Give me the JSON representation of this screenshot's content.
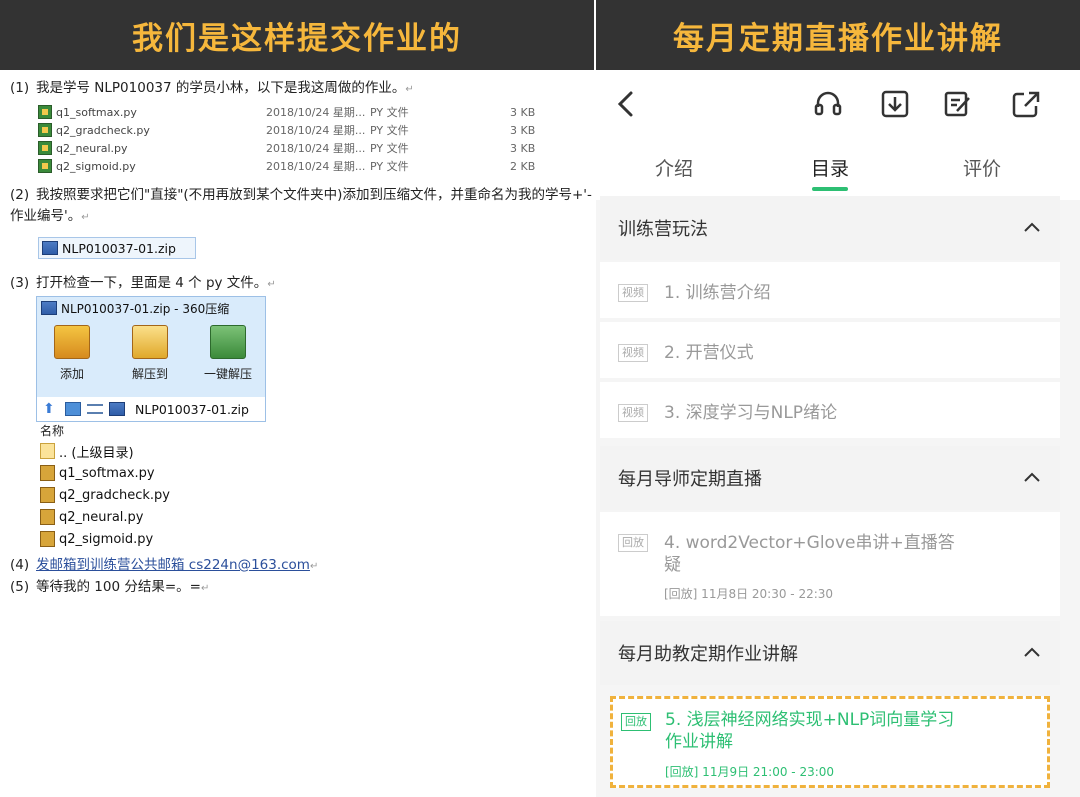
{
  "banners": {
    "left": "我们是这样提交作业的",
    "right": "每月定期直播作业讲解"
  },
  "doc": {
    "steps": [
      {
        "num": "(1)",
        "text": "我是学号 NLP010037 的学员小林，以下是我这周做的作业。"
      },
      {
        "num": "(2)",
        "text": "我按照要求把它们\"直接\"(不用再放到某个文件夹中)添加到压缩文件，并重命名为我的学号+'-作业编号'。"
      },
      {
        "num": "(3)",
        "text": "打开检查一下，里面是 4 个 py 文件。"
      },
      {
        "num": "(4)",
        "text": "发邮箱到训练营公共邮箱 cs224n@163.com"
      },
      {
        "num": "(5)",
        "text": "等待我的 100 分结果=。="
      }
    ],
    "files": [
      {
        "name": "q1_softmax.py",
        "date": "2018/10/24 星期...",
        "type": "PY 文件",
        "size": "3 KB"
      },
      {
        "name": "q2_gradcheck.py",
        "date": "2018/10/24 星期...",
        "type": "PY 文件",
        "size": "3 KB"
      },
      {
        "name": "q2_neural.py",
        "date": "2018/10/24 星期...",
        "type": "PY 文件",
        "size": "3 KB"
      },
      {
        "name": "q2_sigmoid.py",
        "date": "2018/10/24 星期...",
        "type": "PY 文件",
        "size": "2 KB"
      }
    ],
    "zip_name": "NLP010037-01.zip",
    "zipwin": {
      "title": "NLP010037-01.zip - 360压缩",
      "btn_add": "添加",
      "btn_extract": "解压到",
      "btn_onekey": "一键解压",
      "path": "NLP010037-01.zip",
      "col_name": "名称",
      "parent": ".. (上级目录)",
      "items": [
        "q1_softmax.py",
        "q2_gradcheck.py",
        "q2_neural.py",
        "q2_sigmoid.py"
      ]
    }
  },
  "app": {
    "tabs": [
      "介绍",
      "目录",
      "评价"
    ],
    "active_tab": "目录",
    "sections": [
      {
        "title": "训练营玩法"
      },
      {
        "title": "每月导师定期直播"
      },
      {
        "title": "每月助教定期作业讲解"
      }
    ],
    "items": [
      {
        "badge": "视频",
        "title": "1. 训练营介绍"
      },
      {
        "badge": "视频",
        "title": "2. 开营仪式"
      },
      {
        "badge": "视频",
        "title": "3. 深度学习与NLP绪论"
      },
      {
        "badge": "回放",
        "title": "4. word2Vector+Glove串讲+直播答疑",
        "sub": "[回放] 11月8日 20:30 - 22:30"
      },
      {
        "badge": "回放",
        "title": "5. 浅层神经网络实现+NLP词向量学习作业讲解",
        "sub": "[回放] 11月9日 21:00 - 23:00"
      }
    ],
    "accent": "#2dbf73",
    "highlight": "#f0b23d"
  }
}
